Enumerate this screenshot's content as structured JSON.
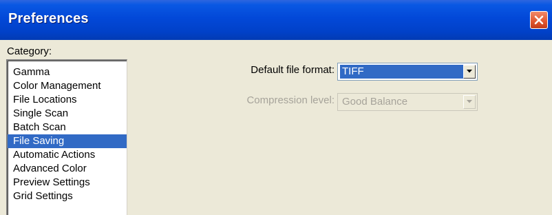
{
  "window": {
    "title": "Preferences"
  },
  "category": {
    "label": "Category:",
    "items": [
      "Gamma",
      "Color Management",
      "File Locations",
      "Single Scan",
      "Batch Scan",
      "File Saving",
      "Automatic Actions",
      "Advanced Color",
      "Preview Settings",
      "Grid Settings"
    ],
    "selected": "File Saving"
  },
  "file_saving": {
    "default_format_label": "Default file format:",
    "default_format_value": "TIFF",
    "compression_label": "Compression level:",
    "compression_value": "Good Balance",
    "compression_enabled": false
  },
  "colors": {
    "selection": "#316ac5",
    "titlebar": "#0248d8",
    "disabled_text": "#a6a39a"
  },
  "icons": {
    "close": "close-x-icon",
    "dropdown": "dropdown-arrow-icon"
  }
}
